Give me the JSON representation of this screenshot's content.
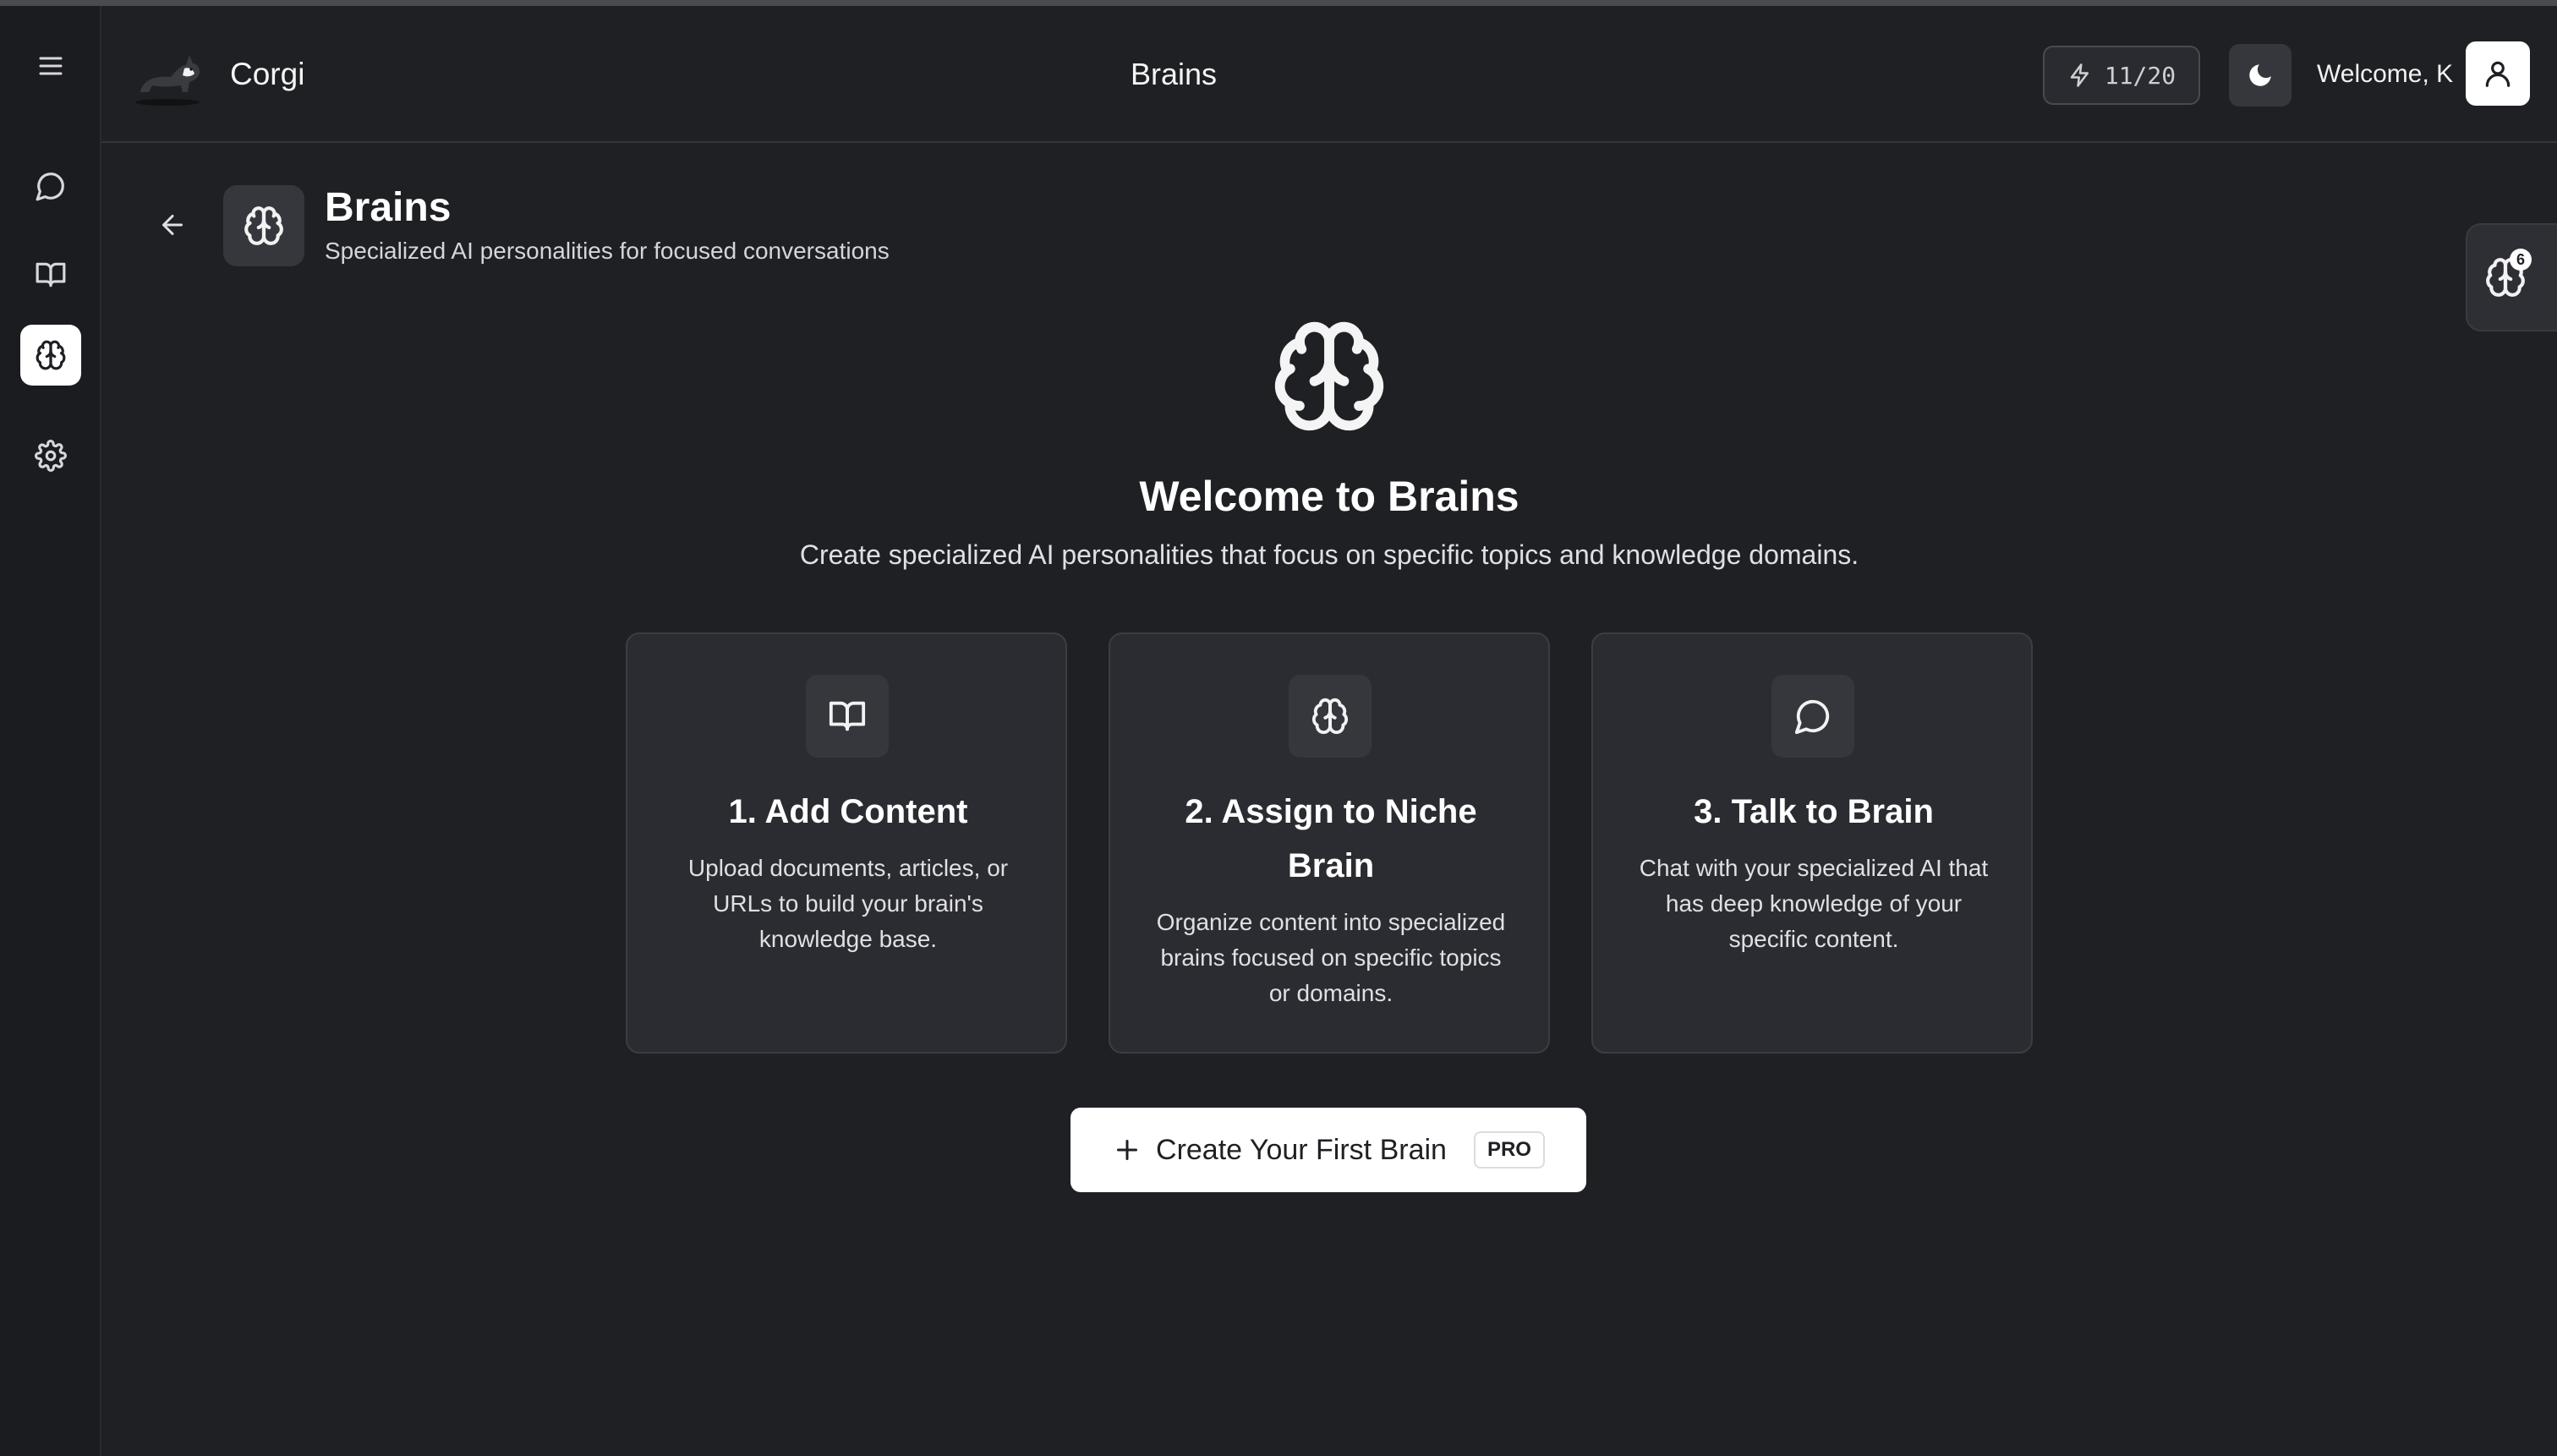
{
  "app": {
    "brand": "Corgi",
    "header_title": "Brains"
  },
  "header": {
    "credits": "11/20",
    "welcome": "Welcome, K"
  },
  "page": {
    "title": "Brains",
    "subtitle": "Specialized AI personalities for focused conversations"
  },
  "float_tab": {
    "badge": "6"
  },
  "hero": {
    "title": "Welcome to Brains",
    "subtitle": "Create specialized AI personalities that focus on specific topics and knowledge domains."
  },
  "steps": [
    {
      "icon": "book-open-icon",
      "title": "1. Add Content",
      "description": "Upload documents, articles, or URLs to build your brain's knowledge base."
    },
    {
      "icon": "brain-icon",
      "title": "2. Assign to Niche Brain",
      "description": "Organize content into specialized brains focused on specific topics or domains."
    },
    {
      "icon": "chat-bubble-icon",
      "title": "3. Talk to Brain",
      "description": "Chat with your specialized AI that has deep knowledge of your specific content."
    }
  ],
  "cta": {
    "label": "Create Your First Brain",
    "badge": "PRO"
  },
  "sidebar": {
    "items": [
      {
        "icon": "menu-icon"
      },
      {
        "icon": "chat-bubble-icon"
      },
      {
        "icon": "book-open-icon"
      },
      {
        "icon": "brain-icon",
        "active": true
      },
      {
        "icon": "gear-icon"
      }
    ]
  }
}
